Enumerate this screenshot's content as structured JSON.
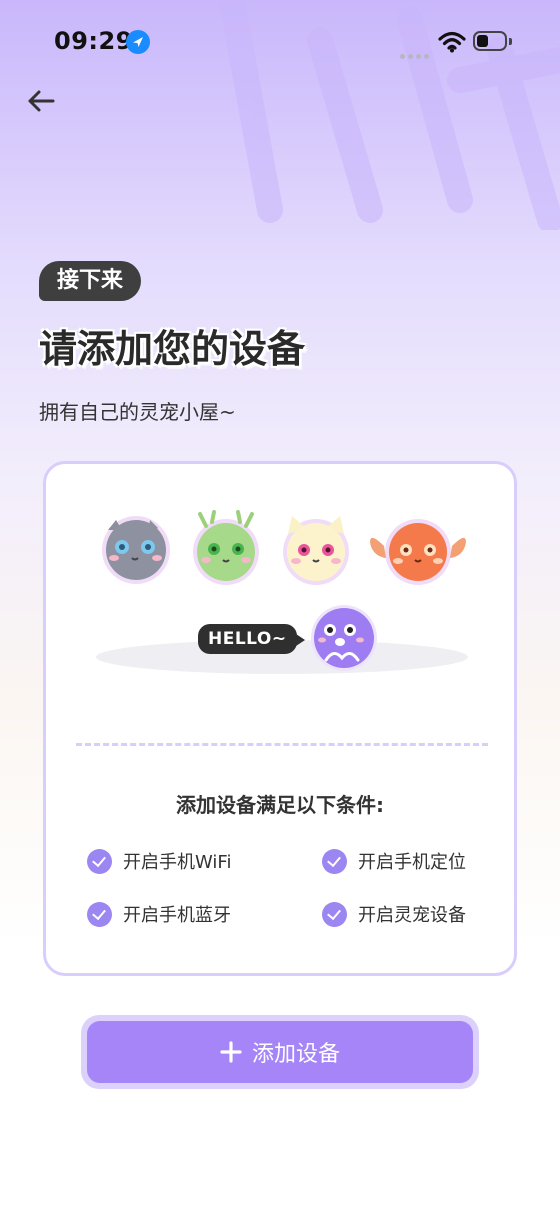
{
  "status_bar": {
    "time": "09:29"
  },
  "header": {
    "step_badge": "接下来",
    "title": "请添加您的设备",
    "subtitle": "拥有自己的灵宠小屋~"
  },
  "card": {
    "hello_text": "HELLO~",
    "requirements_title": "添加设备满足以下条件:",
    "requirements": [
      {
        "label": "开启手机WiFi"
      },
      {
        "label": "开启手机定位"
      },
      {
        "label": "开启手机蓝牙"
      },
      {
        "label": "开启灵宠设备"
      }
    ]
  },
  "actions": {
    "add_device_label": "添加设备"
  },
  "colors": {
    "accent": "#a585f8",
    "accent_light": "#dcd1fb",
    "check": "#9b86f2"
  }
}
